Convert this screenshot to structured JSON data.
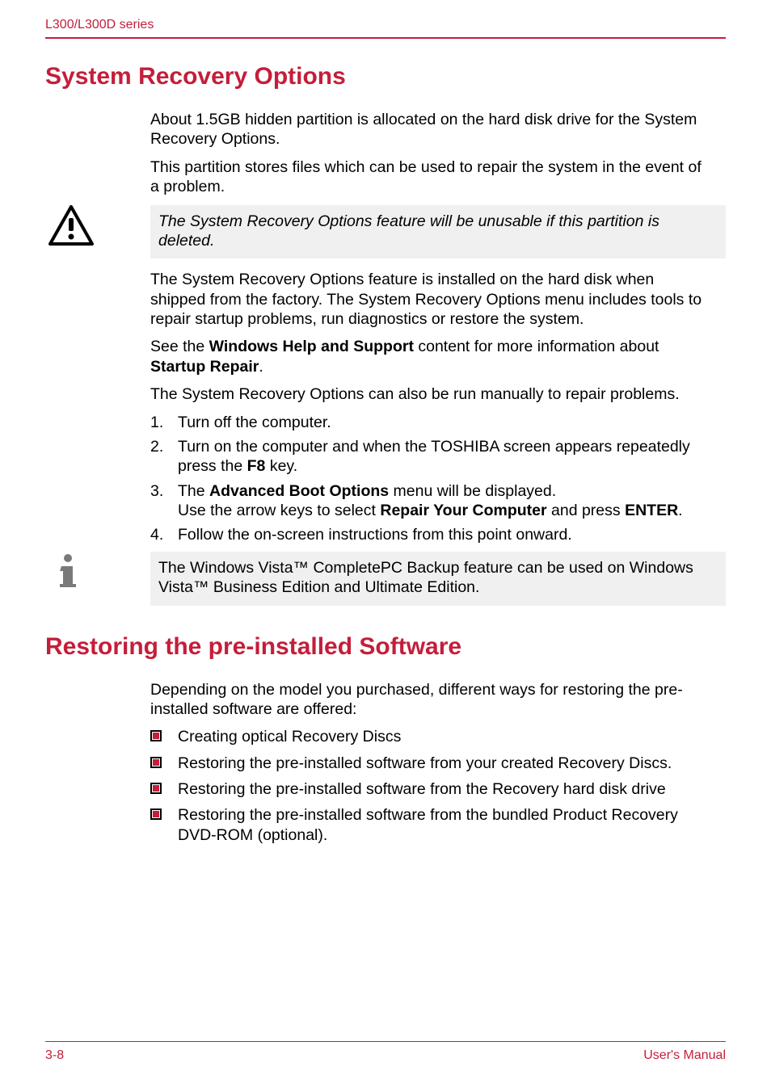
{
  "header": {
    "series": "L300/L300D series"
  },
  "section1": {
    "heading": "System Recovery Options",
    "p1": "About 1.5GB hidden partition is allocated on the hard disk drive for the System Recovery Options.",
    "p2": "This partition stores files which can be used to repair the system in the event of a problem.",
    "warning": "The System Recovery Options feature will be unusable if this partition is deleted.",
    "p3": "The System Recovery Options feature is installed on the hard disk when shipped from the factory. The System Recovery Options menu includes tools to repair startup problems, run diagnostics or restore the system.",
    "p4_pre": "See the ",
    "p4_bold": "Windows Help and Support",
    "p4_mid": " content for more information about ",
    "p4_bold2": "Startup Repair",
    "p4_end": ".",
    "p5": "The System Recovery Options can also be run manually to repair problems.",
    "steps": {
      "s1": "Turn off the computer.",
      "s2_pre": "Turn on the computer and when the TOSHIBA screen appears repeatedly press the ",
      "s2_bold": "F8",
      "s2_end": " key.",
      "s3_pre": "The ",
      "s3_bold1": "Advanced Boot Options",
      "s3_mid1": " menu will be displayed.",
      "s3_line2_pre": "Use the arrow keys to select ",
      "s3_bold2": "Repair Your Computer",
      "s3_mid2": " and press ",
      "s3_bold3": "ENTER",
      "s3_end": ".",
      "s4": "Follow the on-screen instructions from this point onward."
    },
    "info": "The Windows Vista™ CompletePC Backup feature can be used on Windows Vista™ Business Edition and Ultimate Edition."
  },
  "section2": {
    "heading": "Restoring the pre-installed Software",
    "p1": "Depending on the model you purchased, different ways for restoring the pre-installed software are offered:",
    "bullets": {
      "b1": "Creating optical Recovery Discs",
      "b2": "Restoring the pre-installed software from your created Recovery Discs.",
      "b3": "Restoring the pre-installed software from the Recovery hard disk drive",
      "b4": "Restoring the pre-installed software from the bundled Product Recovery DVD-ROM (optional)."
    }
  },
  "footer": {
    "page": "3-8",
    "label": "User's Manual"
  },
  "icons": {
    "warning": "warning-triangle-icon",
    "info": "info-icon"
  }
}
